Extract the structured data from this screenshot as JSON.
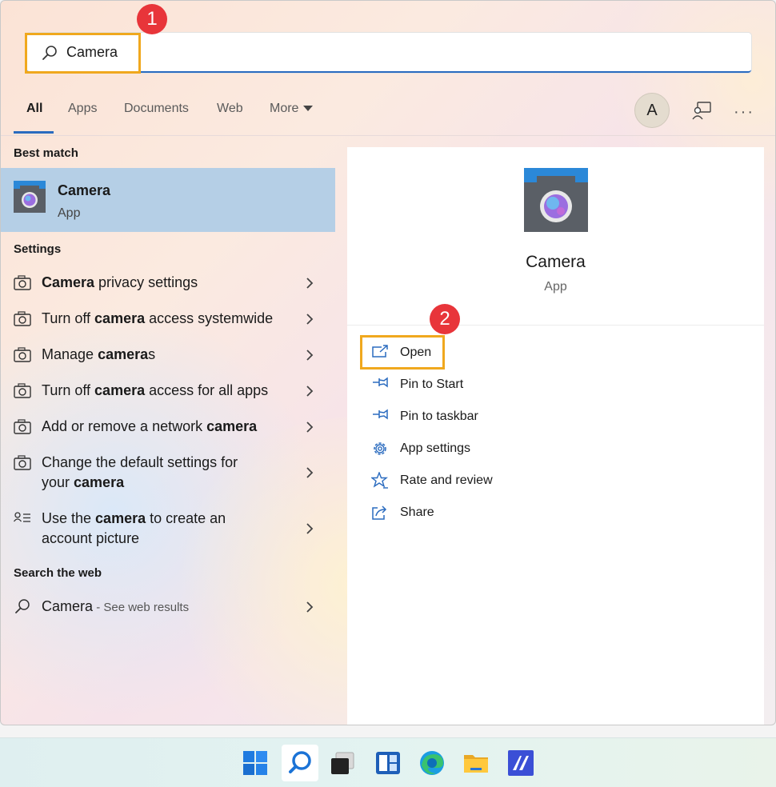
{
  "search": {
    "query": "Camera"
  },
  "annotations": {
    "step1": "1",
    "step2": "2"
  },
  "tabs": [
    {
      "label": "All"
    },
    {
      "label": "Apps"
    },
    {
      "label": "Documents"
    },
    {
      "label": "Web"
    },
    {
      "label": "More"
    }
  ],
  "header": {
    "avatar_initial": "A",
    "more_options": "···"
  },
  "left": {
    "best_match_header": "Best match",
    "best_match": {
      "title": "Camera",
      "subtitle": "App"
    },
    "settings_header": "Settings",
    "settings_items": [
      {
        "pre": "",
        "bold": "Camera",
        "post": " privacy settings"
      },
      {
        "pre": "Turn off ",
        "bold": "camera",
        "post": " access systemwide"
      },
      {
        "pre": "Manage ",
        "bold": "camera",
        "post": "s"
      },
      {
        "pre": "Turn off ",
        "bold": "camera",
        "post": " access for all apps"
      },
      {
        "pre": "Add or remove a network ",
        "bold": "camera",
        "post": ""
      },
      {
        "line1": "Change the default settings for",
        "line2_pre": "your ",
        "line2_bold": "camera"
      },
      {
        "line1_pre": "Use the ",
        "line1_bold": "camera",
        "line1_post": " to create an",
        "line2": "account picture"
      }
    ],
    "web_header": "Search the web",
    "web_item": {
      "label": "Camera",
      "suffix": " - See web results"
    }
  },
  "right": {
    "app_name": "Camera",
    "app_type": "App",
    "actions": [
      {
        "label": "Open",
        "icon": "open-icon"
      },
      {
        "label": "Pin to Start",
        "icon": "pin-icon"
      },
      {
        "label": "Pin to taskbar",
        "icon": "pin-icon"
      },
      {
        "label": "App settings",
        "icon": "gear-icon"
      },
      {
        "label": "Rate and review",
        "icon": "star-icon"
      },
      {
        "label": "Share",
        "icon": "share-icon"
      }
    ]
  },
  "colors": {
    "accent": "#2a6bbf",
    "highlight": "#f0a81e",
    "badge": "#e8353a",
    "selection": "#b5cfe6"
  }
}
